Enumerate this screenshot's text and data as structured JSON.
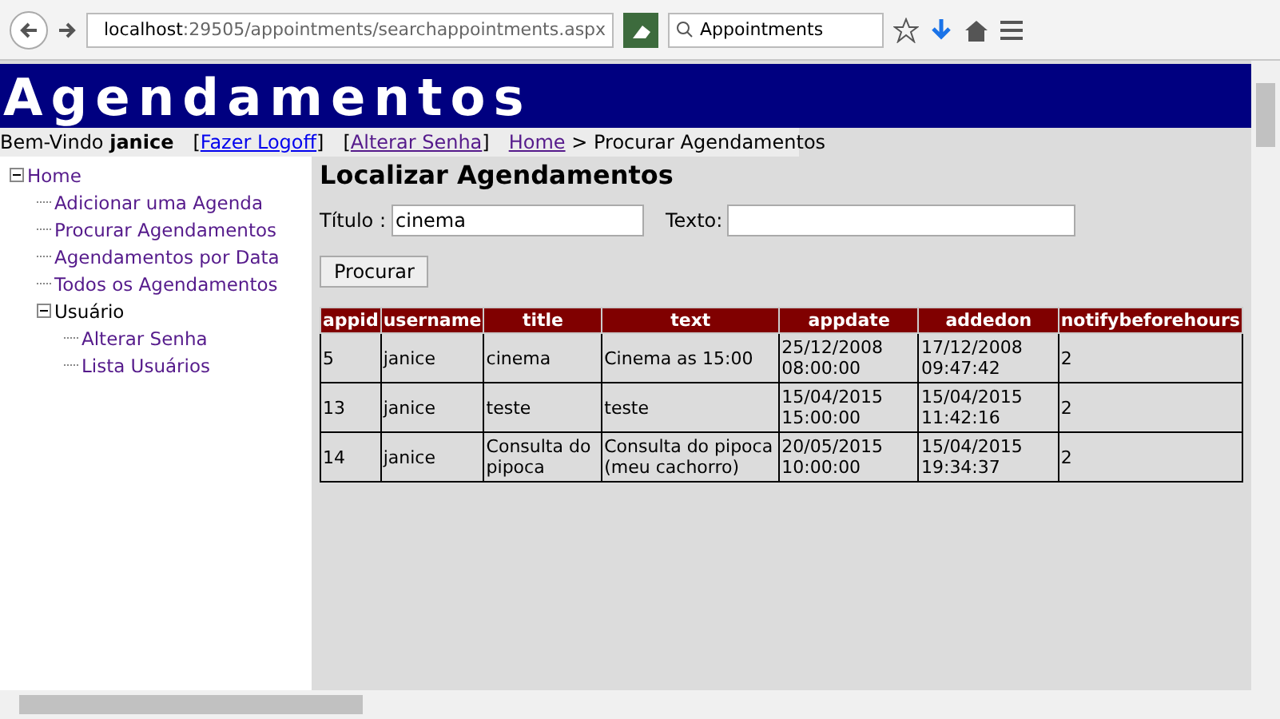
{
  "browser": {
    "url_host": "localhost",
    "url_rest": ":29505/appointments/searchappointments.aspx",
    "search_value": "Appointments"
  },
  "header": {
    "title": "Agendamentos"
  },
  "topbar": {
    "welcome": "Bem-Vindo **janice**",
    "links": [
      {
        "open": "[",
        "label": "Fazer Logoff",
        "close": "]",
        "visited": false
      },
      {
        "open": "[",
        "label": "Alterar Senha",
        "close": "]",
        "visited": true
      }
    ],
    "breadcrumb": {
      "home": "Home",
      "separator": ">",
      "current": "Procurar Agendamentos"
    }
  },
  "tree": [
    {
      "label": "Home",
      "kind": "link",
      "expanded": true,
      "children": [
        {
          "label": "Adicionar uma Agenda",
          "kind": "link"
        },
        {
          "label": "Procurar Agendamentos",
          "kind": "link"
        },
        {
          "label": "Agendamentos por Data",
          "kind": "link"
        },
        {
          "label": "Todos os Agendamentos",
          "kind": "link"
        },
        {
          "label": "Usuário",
          "kind": "label",
          "expanded": true,
          "children": [
            {
              "label": "Alterar Senha",
              "kind": "link"
            },
            {
              "label": "Lista Usuários",
              "kind": "link"
            }
          ]
        }
      ]
    }
  ],
  "main": {
    "heading": "Localizar Agendamentos",
    "fields": [
      {
        "label": "Título :",
        "value": "cinema"
      },
      {
        "label": "Texto:"
      }
    ],
    "button": "Procurar"
  },
  "table": {
    "columns": [
      "appid",
      "username",
      "title",
      "text",
      "appdate",
      "addedon",
      "notifybeforehours"
    ],
    "rows": [
      [
        "5",
        "janice",
        "cinema",
        "Cinema as 15:00",
        "25/12/2008 08:00:00",
        "17/12/2008 09:47:42",
        "2"
      ],
      [
        "13",
        "janice",
        "teste",
        "teste",
        "15/04/2015 15:00:00",
        "15/04/2015 11:42:16",
        "2"
      ],
      [
        "14",
        "janice",
        "Consulta do pipoca",
        "Consulta do pipoca (meu cachorro)",
        "20/05/2015 10:00:00",
        "15/04/2015 19:34:37",
        "2"
      ]
    ]
  }
}
